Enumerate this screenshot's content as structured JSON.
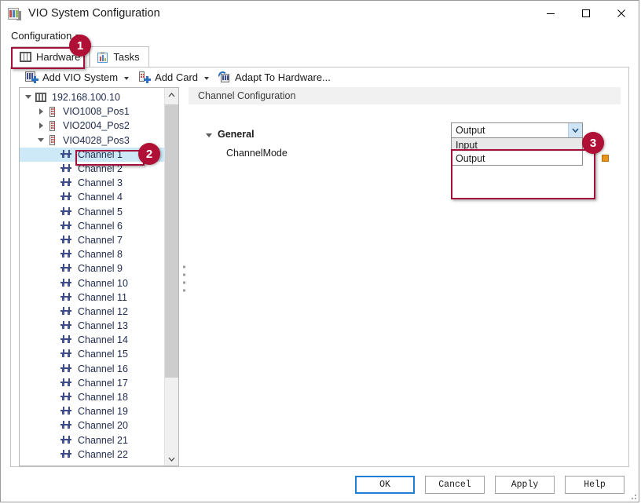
{
  "window": {
    "title": "VIO System Configuration",
    "icon": "vio-rack-icon",
    "controls": {
      "minimize": "minimize-icon",
      "maximize": "maximize-icon",
      "close": "close-icon"
    }
  },
  "menu": {
    "items": [
      {
        "label": "Configuration",
        "has_caret": true
      }
    ]
  },
  "tabs": [
    {
      "label": "Hardware",
      "icon": "hardware-icon",
      "selected": true
    },
    {
      "label": "Tasks",
      "icon": "tasks-clipboard-icon",
      "selected": false
    }
  ],
  "toolbar": {
    "items": [
      {
        "label": "Add VIO System",
        "icon": "add-vio-system-icon",
        "has_caret": true
      },
      {
        "label": "Add Card",
        "icon": "add-card-icon",
        "has_caret": true
      },
      {
        "label": "Adapt To Hardware...",
        "icon": "adapt-to-hardware-icon",
        "has_caret": false
      }
    ]
  },
  "tree": {
    "nodes": [
      {
        "label": "192.168.100.10",
        "indent": 0,
        "expander": "expanded",
        "icon": "vio-rack-icon",
        "selected": false
      },
      {
        "label": "VIO1008_Pos1",
        "indent": 1,
        "expander": "collapsed",
        "icon": "card-icon",
        "selected": false
      },
      {
        "label": "VIO2004_Pos2",
        "indent": 1,
        "expander": "collapsed",
        "icon": "card-icon",
        "selected": false
      },
      {
        "label": "VIO4028_Pos3",
        "indent": 1,
        "expander": "expanded",
        "icon": "card-icon",
        "selected": false
      },
      {
        "label": "Channel 1",
        "indent": 2,
        "expander": "none",
        "icon": "channel-icon",
        "selected": true
      },
      {
        "label": "Channel 2",
        "indent": 2,
        "expander": "none",
        "icon": "channel-icon",
        "selected": false
      },
      {
        "label": "Channel 3",
        "indent": 2,
        "expander": "none",
        "icon": "channel-icon",
        "selected": false
      },
      {
        "label": "Channel 4",
        "indent": 2,
        "expander": "none",
        "icon": "channel-icon",
        "selected": false
      },
      {
        "label": "Channel 5",
        "indent": 2,
        "expander": "none",
        "icon": "channel-icon",
        "selected": false
      },
      {
        "label": "Channel 6",
        "indent": 2,
        "expander": "none",
        "icon": "channel-icon",
        "selected": false
      },
      {
        "label": "Channel 7",
        "indent": 2,
        "expander": "none",
        "icon": "channel-icon",
        "selected": false
      },
      {
        "label": "Channel 8",
        "indent": 2,
        "expander": "none",
        "icon": "channel-icon",
        "selected": false
      },
      {
        "label": "Channel 9",
        "indent": 2,
        "expander": "none",
        "icon": "channel-icon",
        "selected": false
      },
      {
        "label": "Channel 10",
        "indent": 2,
        "expander": "none",
        "icon": "channel-icon",
        "selected": false
      },
      {
        "label": "Channel 11",
        "indent": 2,
        "expander": "none",
        "icon": "channel-icon",
        "selected": false
      },
      {
        "label": "Channel 12",
        "indent": 2,
        "expander": "none",
        "icon": "channel-icon",
        "selected": false
      },
      {
        "label": "Channel 13",
        "indent": 2,
        "expander": "none",
        "icon": "channel-icon",
        "selected": false
      },
      {
        "label": "Channel 14",
        "indent": 2,
        "expander": "none",
        "icon": "channel-icon",
        "selected": false
      },
      {
        "label": "Channel 15",
        "indent": 2,
        "expander": "none",
        "icon": "channel-icon",
        "selected": false
      },
      {
        "label": "Channel 16",
        "indent": 2,
        "expander": "none",
        "icon": "channel-icon",
        "selected": false
      },
      {
        "label": "Channel 17",
        "indent": 2,
        "expander": "none",
        "icon": "channel-icon",
        "selected": false
      },
      {
        "label": "Channel 18",
        "indent": 2,
        "expander": "none",
        "icon": "channel-icon",
        "selected": false
      },
      {
        "label": "Channel 19",
        "indent": 2,
        "expander": "none",
        "icon": "channel-icon",
        "selected": false
      },
      {
        "label": "Channel 20",
        "indent": 2,
        "expander": "none",
        "icon": "channel-icon",
        "selected": false
      },
      {
        "label": "Channel 21",
        "indent": 2,
        "expander": "none",
        "icon": "channel-icon",
        "selected": false
      },
      {
        "label": "Channel 22",
        "indent": 2,
        "expander": "none",
        "icon": "channel-icon",
        "selected": false
      }
    ],
    "scrollbar": {
      "up_icon": "chevron-up-icon",
      "down_icon": "chevron-down-icon"
    }
  },
  "right_pane": {
    "header": "Channel Configuration",
    "group": {
      "label": "General",
      "expanded": true
    },
    "properties": [
      {
        "label": "ChannelMode",
        "value": "Output"
      }
    ],
    "combo": {
      "value": "Output",
      "arrow_icon": "chevron-down-icon",
      "expanded": true,
      "options": [
        {
          "label": "Input",
          "hover": true
        },
        {
          "label": "Output",
          "hover": false
        }
      ]
    },
    "marker": "modified-value-marker"
  },
  "buttons": [
    {
      "label": "OK",
      "default": true
    },
    {
      "label": "Cancel",
      "default": false
    },
    {
      "label": "Apply",
      "default": false
    },
    {
      "label": "Help",
      "default": false
    }
  ],
  "annotations": [
    {
      "number": "1",
      "target": "hardware-tab"
    },
    {
      "number": "2",
      "target": "channel-1-tree-item"
    },
    {
      "number": "3",
      "target": "channelmode-dropdown"
    }
  ],
  "colors": {
    "annotation": "#b01035",
    "selection": "#cde8f6",
    "combo_arrow": "#cfe4f5",
    "marker_orange": "#e8941a",
    "default_button_border": "#1f7fd4"
  }
}
